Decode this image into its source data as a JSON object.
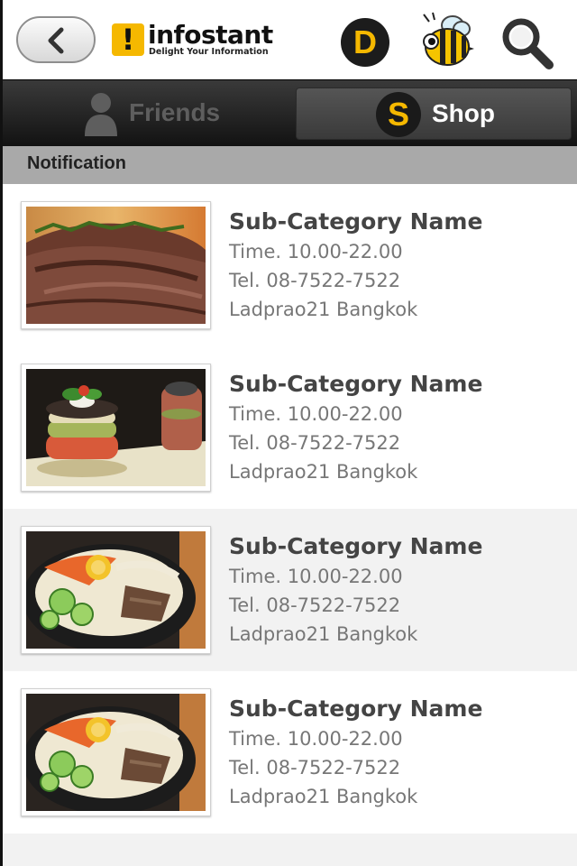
{
  "header": {
    "logo_mark": "!",
    "logo_name": "infostant",
    "logo_tagline": "Delight Your Information",
    "d_icon_letter": "D",
    "icons": [
      "back-arrow-icon",
      "d-icon",
      "bee-icon",
      "search-icon"
    ]
  },
  "tabs": [
    {
      "label": "Friends",
      "icon": "person-icon",
      "active": false
    },
    {
      "label": "Shop",
      "icon_letter": "S",
      "active": true
    }
  ],
  "section": {
    "title": "Notification"
  },
  "items": [
    {
      "title": "Sub-Category Name",
      "time": "Time. 10.00-22.00",
      "tel": "Tel. 08-7522-7522",
      "location": "Ladprao21 Bangkok",
      "image": "grilled-steak"
    },
    {
      "title": "Sub-Category Name",
      "time": "Time. 10.00-22.00",
      "tel": "Tel. 08-7522-7522",
      "location": "Ladprao21 Bangkok",
      "image": "vegetable-stack"
    },
    {
      "title": "Sub-Category Name",
      "time": "Time. 10.00-22.00",
      "tel": "Tel. 08-7522-7522",
      "location": "Ladprao21 Bangkok",
      "image": "bibimbap"
    },
    {
      "title": "Sub-Category Name",
      "time": "Time. 10.00-22.00",
      "tel": "Tel. 08-7522-7522",
      "location": "Ladprao21 Bangkok",
      "image": "bibimbap"
    }
  ],
  "colors": {
    "accent": "#f5b800",
    "tabbar": "#1e1e1e",
    "section": "#a9a9a9"
  }
}
